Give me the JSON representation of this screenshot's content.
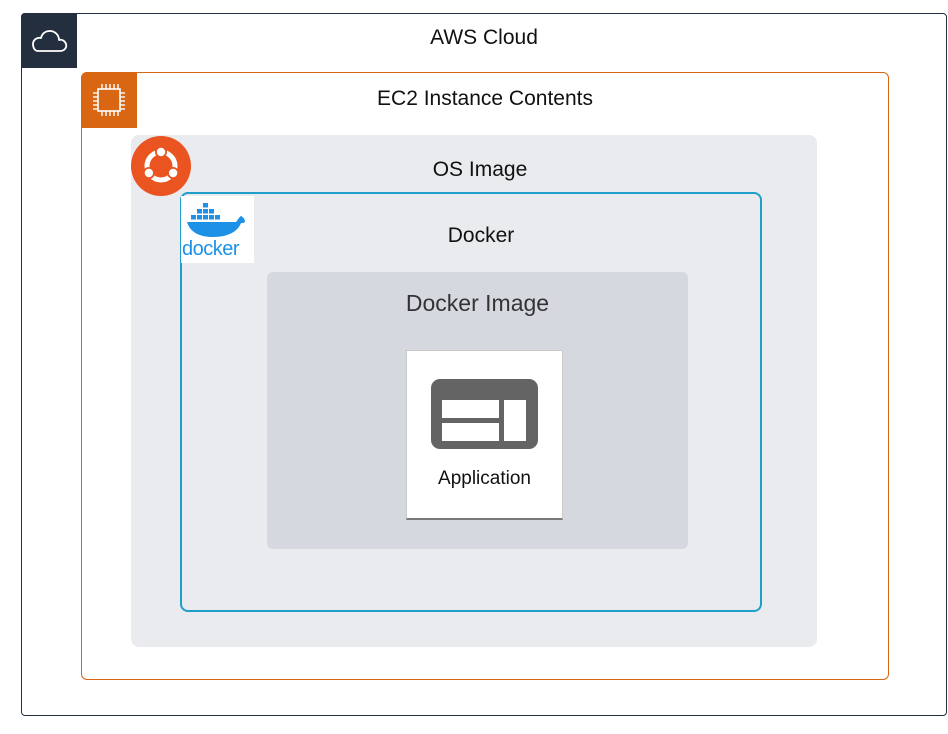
{
  "groups": {
    "aws_cloud": {
      "label": "AWS Cloud",
      "icon": "cloud-icon",
      "color": "#232f3e"
    },
    "ec2_instance": {
      "label": "EC2 Instance Contents",
      "icon": "ec2-chip-icon",
      "color": "#d86613"
    },
    "os_image": {
      "label": "OS Image",
      "icon": "ubuntu-logo-icon",
      "color": "#e95420"
    },
    "docker": {
      "label": "Docker",
      "icon": "docker-logo-icon",
      "logo_text": "docker",
      "color": "#1f9ec9"
    },
    "docker_image": {
      "label": "Docker Image"
    }
  },
  "application": {
    "label": "Application",
    "icon": "application-window-icon"
  }
}
